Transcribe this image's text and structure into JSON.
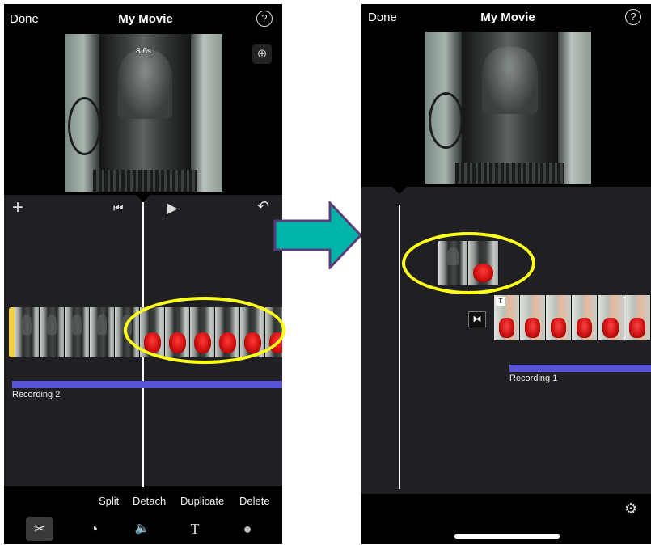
{
  "left_screen": {
    "done_label": "Done",
    "title": "My Movie",
    "help_glyph": "?",
    "duration_label": "8.6s",
    "zoom_glyph": "⊕",
    "toolbar": {
      "add_glyph": "+",
      "rewind_glyph": "⏮",
      "play_glyph": "▶",
      "undo_glyph": "↶"
    },
    "audio_track_label": "Recording 2",
    "actions": [
      "Split",
      "Detach",
      "Duplicate",
      "Delete"
    ],
    "tools": [
      {
        "name": "scissors-icon",
        "glyph": "✂",
        "selected": true
      },
      {
        "name": "speed-gauge-icon",
        "glyph": "◔",
        "selected": false
      },
      {
        "name": "volume-icon",
        "glyph": "🔈",
        "selected": false
      },
      {
        "name": "text-icon",
        "glyph": "T",
        "selected": false
      },
      {
        "name": "filters-icon",
        "glyph": "●",
        "selected": false
      }
    ]
  },
  "right_screen": {
    "done_label": "Done",
    "title": "My Movie",
    "help_glyph": "?",
    "transition_glyph": "⧓",
    "title_badge": "T",
    "audio_track_label": "Recording 1",
    "settings_glyph": "⚙"
  },
  "colors": {
    "highlight": "#ffff1a",
    "arrow_fill": "#00b5a8",
    "arrow_border": "#5a3d7a",
    "audio_track": "#5a55d6",
    "clip_handle": "#f4d13a"
  }
}
